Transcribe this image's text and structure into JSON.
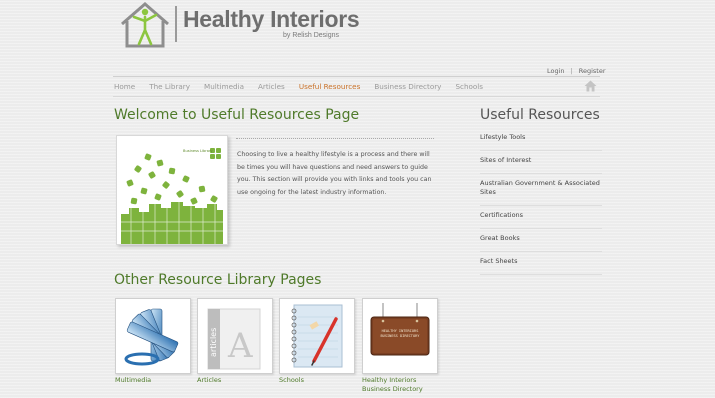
{
  "logo": {
    "title": "Healthy Interiors",
    "subtitle": "by Relish Designs"
  },
  "account": {
    "login": "Login",
    "separator": "|",
    "register": "Register"
  },
  "nav": {
    "items": [
      "Home",
      "The Library",
      "Multimedia",
      "Articles",
      "Useful Resources",
      "Business Directory",
      "Schools"
    ],
    "active": "Useful Resources"
  },
  "main": {
    "title": "Welcome to Useful Resources Page",
    "intro": "Choosing to live a healthy lifestyle is a process and there will be times you will have questions and need answers to guide you. This section will provide you with links and tools you can use ongoing for the latest industry information.",
    "feature_image": {
      "label": "Business Library"
    }
  },
  "sidebar": {
    "title": "Useful Resources",
    "items": [
      "Lifestyle Tools",
      "Sites of Interest",
      "Australian Government & Associated Sites",
      "Certifications",
      "Great Books",
      "Fact Sheets"
    ]
  },
  "other": {
    "title": "Other Resource Library Pages",
    "thumbs": [
      {
        "label": "Multimedia"
      },
      {
        "label": "Articles"
      },
      {
        "label": "Schools"
      },
      {
        "label": "Healthy Interiors Business Directory",
        "sign_text": "HEALTHY INTERIORS BUSINESS DIRECTORY"
      }
    ],
    "articles_spine_text": "articles"
  },
  "colors": {
    "heading_green": "#4f7a2a",
    "nav_active": "#c9722a",
    "logo_green": "#8cc63f"
  }
}
